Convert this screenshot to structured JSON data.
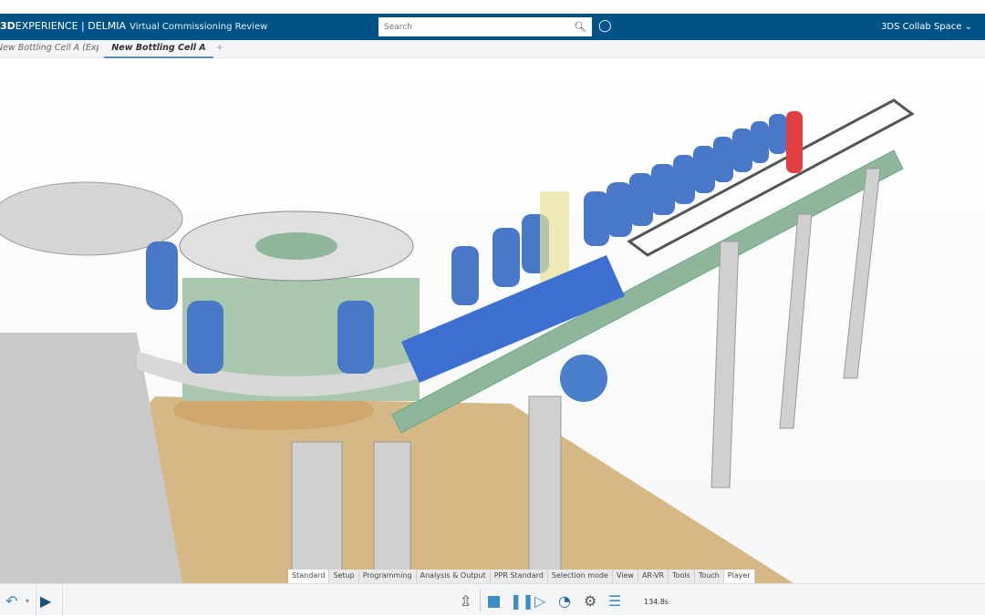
{
  "header": {
    "brand_prefix": "3D",
    "brand_main": "EXPERIENCE | DELMIA",
    "app_name": "Virtual Commissioning Review",
    "search_placeholder": "Search",
    "collab_space": "3DS Collab Space"
  },
  "tabs": [
    {
      "label": "New Bottling Cell A (Explore)"
    },
    {
      "label": "New Bottling Cell A",
      "active": true
    }
  ],
  "add_tab": "+",
  "action_bar": [
    {
      "label": "Standard",
      "active": true
    },
    {
      "label": "Setup"
    },
    {
      "label": "Programming"
    },
    {
      "label": "Analysis & Output"
    },
    {
      "label": "PPR Standard"
    },
    {
      "label": "Selection mode"
    },
    {
      "label": "View"
    },
    {
      "label": "AR-VR"
    },
    {
      "label": "Tools"
    },
    {
      "label": "Touch"
    },
    {
      "label": "Player",
      "active": true
    }
  ],
  "toolbar": {
    "time": "134.8s",
    "icons": [
      "undo-icon",
      "publish-icon",
      "export-icon",
      "stop-icon",
      "pause-icon",
      "step-forward-icon",
      "speedometer-icon",
      "settings-icon",
      "list-icon"
    ]
  },
  "colors": {
    "header": "#005386",
    "accent": "#3d8cc4",
    "bottle": "#4a78c8",
    "floor": "#d6b887"
  }
}
